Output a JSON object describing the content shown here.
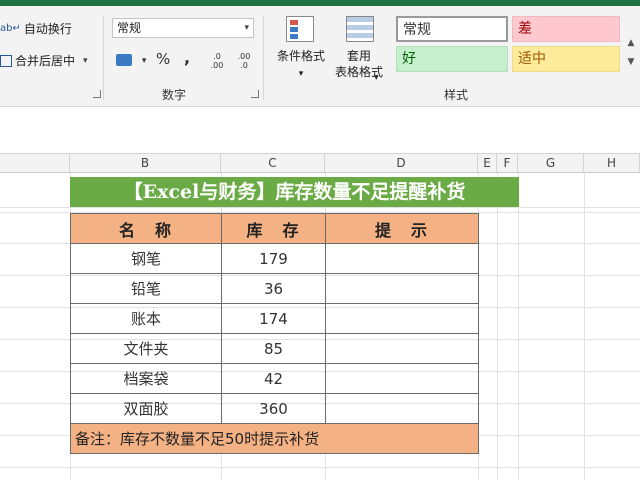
{
  "ribbon": {
    "wrap_text": "自动换行",
    "merge_center": "合并后居中",
    "merge_arrow": "▾",
    "number_format": "常规",
    "combo_arrow": "▾",
    "accounting_icon": "accounting-icon",
    "percent": "%",
    "comma": ",",
    "inc_decimal": ".0 .00",
    "dec_decimal": ".00 .0",
    "number_group": "数字",
    "cond_format": "条件格式",
    "cond_arrow": "▾",
    "table_format_1": "套用",
    "table_format_2": "表格格式",
    "table_arrow": "▾",
    "styles_group": "样式",
    "styles": {
      "normal": "常规",
      "bad": "差",
      "good": "好",
      "neutral": "适中"
    },
    "colors": {
      "normal_border": "#9a9a9a",
      "bad_bg": "#ffc7ce",
      "bad_text": "#9c0006",
      "good_bg": "#c6efce",
      "good_text": "#006100",
      "neutral_bg": "#ffeb9c",
      "neutral_text": "#9c5700"
    }
  },
  "columns": [
    "B",
    "C",
    "D",
    "E",
    "F",
    "G",
    "H"
  ],
  "sheet": {
    "title": "【Excel与财务】库存数量不足提醒补货",
    "headers": [
      "名　称",
      "库　存",
      "提　示"
    ],
    "rows": [
      {
        "name": "钢笔",
        "stock": "179",
        "hint": ""
      },
      {
        "name": "铅笔",
        "stock": "36",
        "hint": ""
      },
      {
        "name": "账本",
        "stock": "174",
        "hint": ""
      },
      {
        "name": "文件夹",
        "stock": "85",
        "hint": ""
      },
      {
        "name": "档案袋",
        "stock": "42",
        "hint": ""
      },
      {
        "name": "双面胶",
        "stock": "360",
        "hint": ""
      }
    ],
    "note": "备注：库存不数量不足50时提示补货",
    "colors": {
      "title_bg": "#6aab46",
      "header_bg": "#f4b183"
    }
  }
}
